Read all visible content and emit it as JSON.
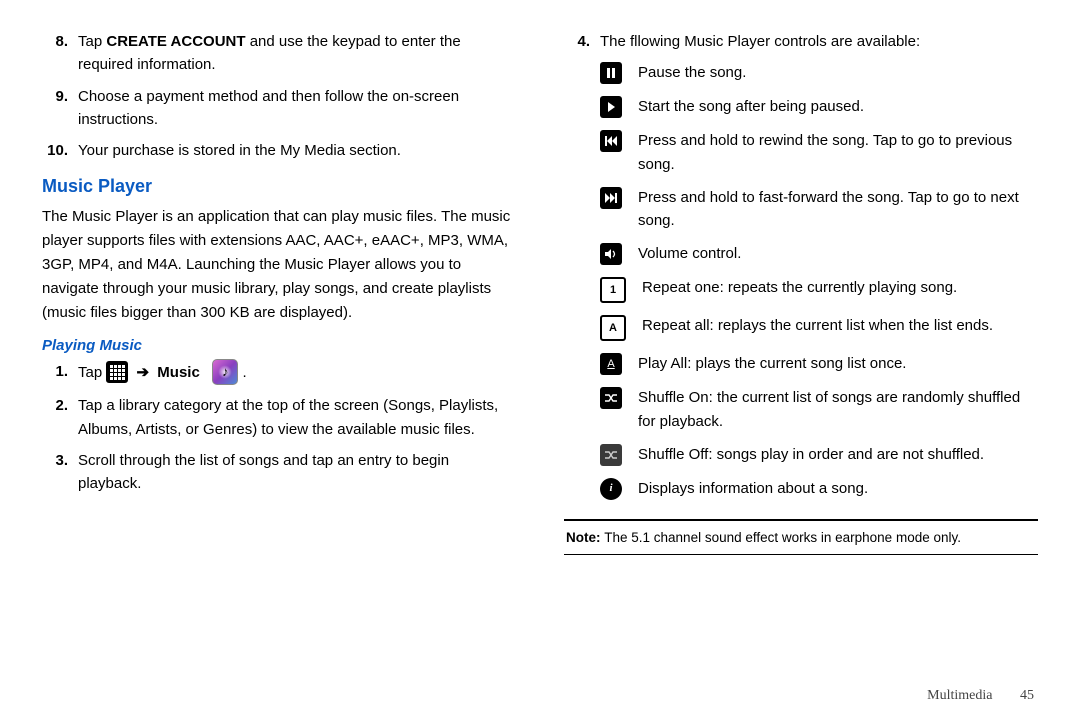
{
  "left": {
    "steps_a": [
      {
        "n": "8.",
        "pre": "Tap ",
        "bold": "CREATE ACCOUNT",
        "post": " and use the keypad to enter the required information."
      },
      {
        "n": "9.",
        "text": "Choose a payment method and then follow the on-screen instructions."
      },
      {
        "n": "10.",
        "text": "Your purchase is stored in the My Media section."
      }
    ],
    "h2": "Music Player",
    "intro": "The Music Player is an application that can play music files. The music player supports files with extensions AAC, AAC+, eAAC+, MP3, WMA, 3GP, MP4, and M4A. Launching the Music Player allows you to navigate through your music library, play songs, and create playlists (music files bigger than 300 KB are displayed).",
    "h3": "Playing Music",
    "steps_b": {
      "s1": {
        "n": "1.",
        "tap": "Tap ",
        "music": "Music",
        "period": "."
      },
      "s2": {
        "n": "2.",
        "text": "Tap a library category at the top of the screen (Songs, Playlists, Albums, Artists, or Genres) to view the available music files."
      },
      "s3": {
        "n": "3.",
        "text": "Scroll through the list of songs and tap an entry to begin playback."
      }
    }
  },
  "right": {
    "lead": {
      "n": "4.",
      "text": "The fllowing Music Player controls are available:"
    },
    "controls": [
      {
        "icon": "pause",
        "label": "Pause the song."
      },
      {
        "icon": "play",
        "label": "Start the song after being paused."
      },
      {
        "icon": "prev",
        "label": "Press and hold to rewind the song. Tap to go to previous song."
      },
      {
        "icon": "next",
        "label": "Press and hold to fast-forward  the song. Tap to go to next song."
      },
      {
        "icon": "volume",
        "label": "Volume control."
      },
      {
        "icon": "repeat1",
        "label": "Repeat one: repeats the currently playing song."
      },
      {
        "icon": "repeatA",
        "label": "Repeat all: replays the current list when the list ends."
      },
      {
        "icon": "playall",
        "label": "Play All: plays the current song list once."
      },
      {
        "icon": "shuffleOn",
        "label": "Shuffle On: the current list of songs are randomly shuffled for playback."
      },
      {
        "icon": "shuffleOff",
        "label": "Shuffle Off: songs play in order and are not shuffled."
      },
      {
        "icon": "info",
        "label": "Displays information about a song."
      }
    ],
    "note": {
      "label": "Note: ",
      "text": "The 5.1 channel sound effect works in earphone mode only."
    }
  },
  "footer": {
    "section": "Multimedia",
    "page": "45"
  }
}
